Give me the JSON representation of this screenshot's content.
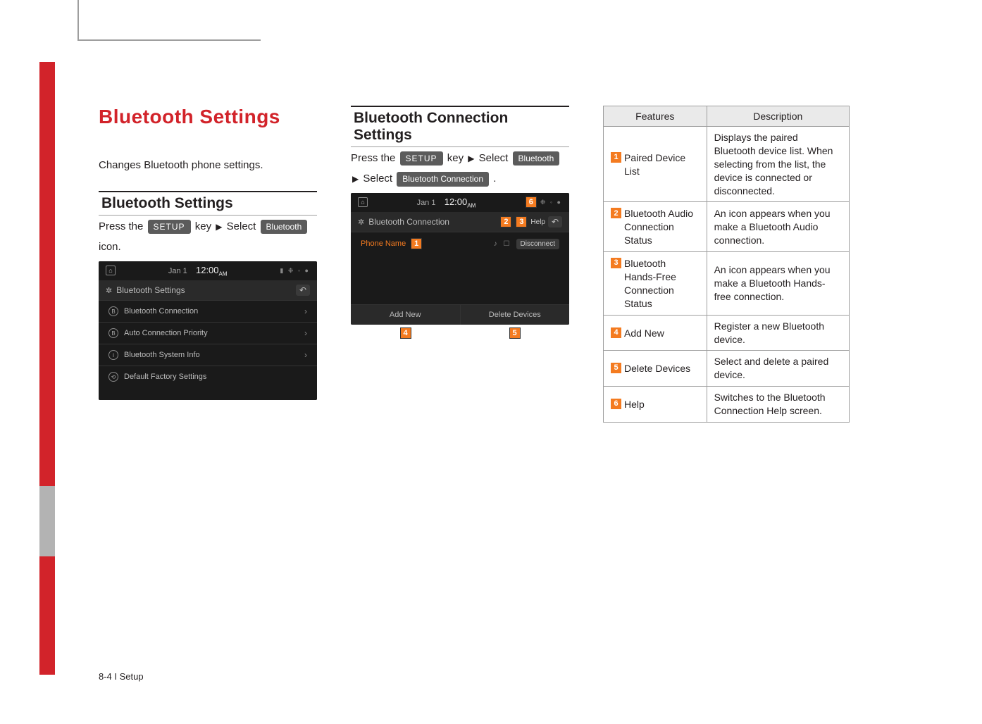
{
  "page_title": "Bluetooth Settings",
  "intro": "Changes Bluetooth phone settings.",
  "section1": {
    "heading": "Bluetooth Settings",
    "press_the": "Press the",
    "setup_key": "SETUP",
    "key_text": "key",
    "select_text": "Select",
    "bluetooth_pill": "Bluetooth",
    "icon_text": "icon."
  },
  "shot1": {
    "date": "Jan   1",
    "time": "12:00",
    "ampm": "AM",
    "header": "Bluetooth Settings",
    "rows": [
      "Bluetooth Connection",
      "Auto Connection Priority",
      "Bluetooth System Info",
      "Default Factory Settings"
    ]
  },
  "section2": {
    "heading": "Bluetooth Connection Settings",
    "press_the": "Press the",
    "setup_key": "SETUP",
    "key_text": "key",
    "select_text": "Select",
    "bluetooth_pill": "Bluetooth",
    "select2": "Select",
    "conn_pill": "Bluetooth Connection"
  },
  "shot2": {
    "date": "Jan   1",
    "time": "12:00",
    "ampm": "AM",
    "header": "Bluetooth Connection",
    "help": "Help",
    "phone_name": "Phone Name",
    "disconnect": "Disconnect",
    "add_new": "Add New",
    "delete_devices": "Delete Devices"
  },
  "table": {
    "head_features": "Features",
    "head_description": "Description",
    "rows": [
      {
        "n": "1",
        "feature": "Paired Device List",
        "desc": "Displays the paired Bluetooth device list. When selecting from the list, the device is connected or disconnected."
      },
      {
        "n": "2",
        "feature": "Bluetooth Audio Connection Status",
        "desc": "An icon appears when you make a Bluetooth Audio connection."
      },
      {
        "n": "3",
        "feature": "Bluetooth Hands-Free Connection Status",
        "desc": "An icon appears when you make a Bluetooth Hands-free connection."
      },
      {
        "n": "4",
        "feature": "Add New",
        "desc": "Register a new Bluetooth device."
      },
      {
        "n": "5",
        "feature": "Delete Devices",
        "desc": "Select and delete a paired device."
      },
      {
        "n": "6",
        "feature": "Help",
        "desc": "Switches to the Bluetooth Connection Help screen."
      }
    ]
  },
  "footer": "8-4 I Setup"
}
